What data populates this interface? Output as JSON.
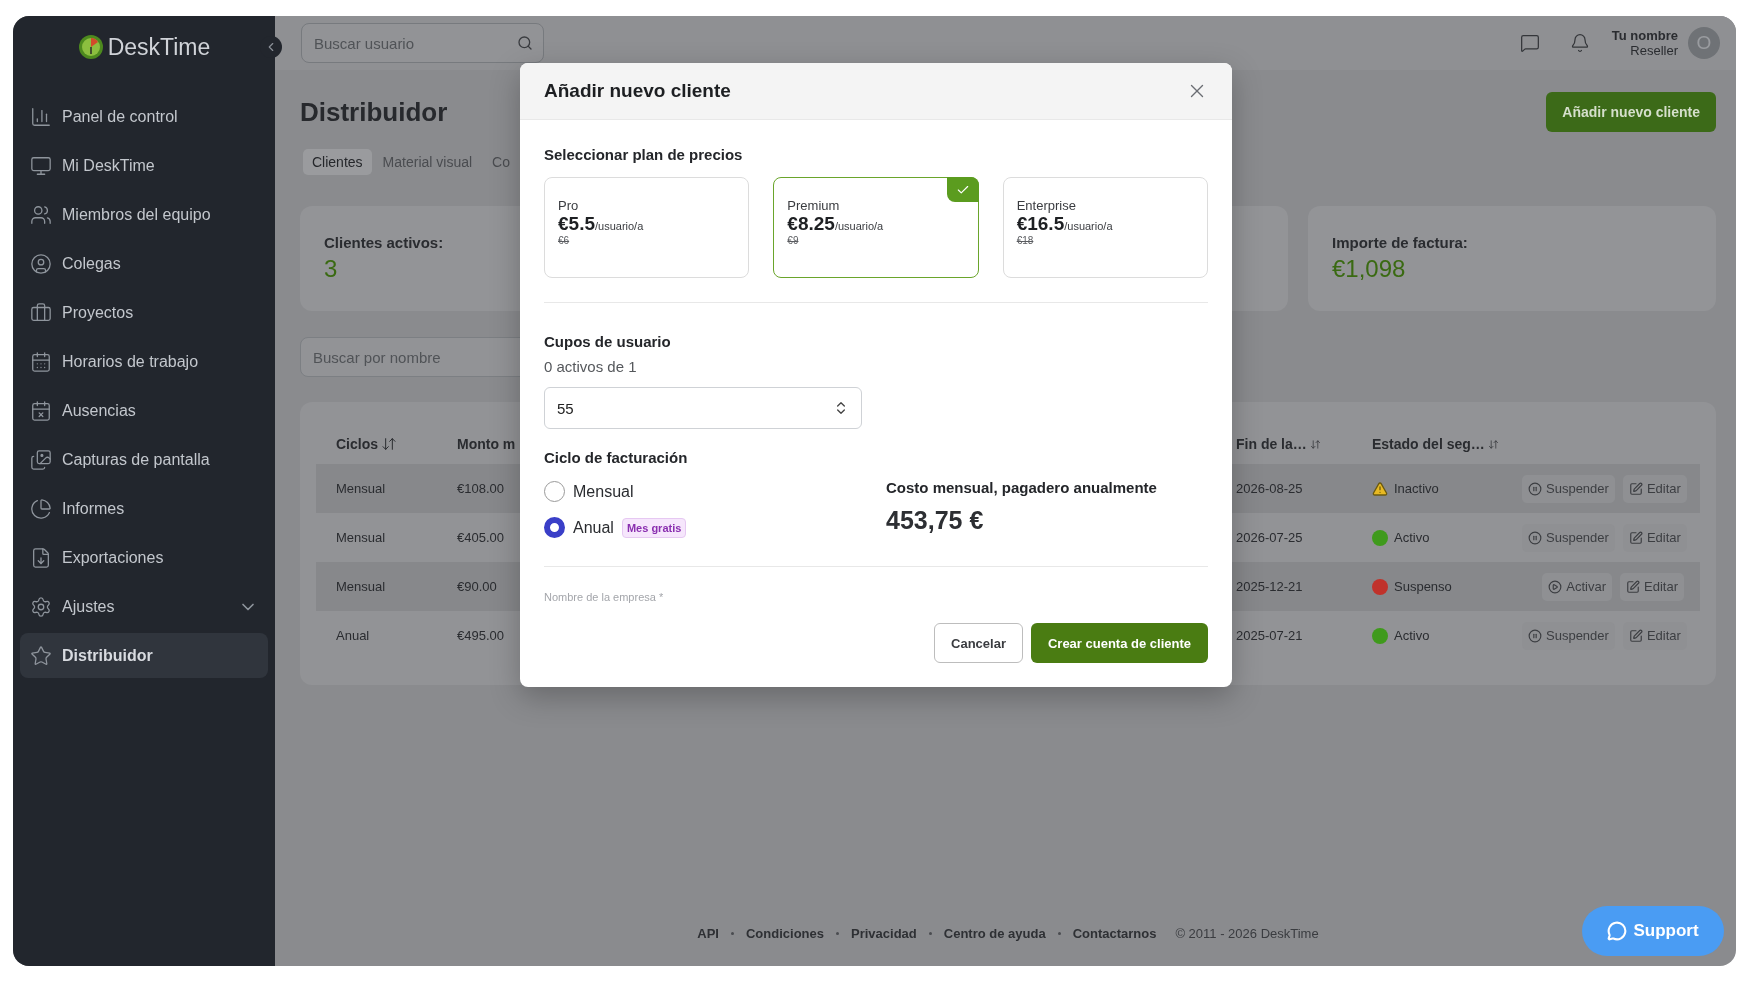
{
  "sidebar": {
    "logo": "DeskTime",
    "items": [
      {
        "label": "Panel de control",
        "selected": false,
        "kind": "link"
      },
      {
        "label": "Mi DeskTime",
        "selected": false,
        "kind": "link"
      },
      {
        "label": "Miembros del equipo",
        "selected": false,
        "kind": "link"
      },
      {
        "label": "Colegas",
        "selected": false,
        "kind": "link"
      },
      {
        "label": "Proyectos",
        "selected": false,
        "kind": "link"
      },
      {
        "label": "Horarios de trabajo",
        "selected": false,
        "kind": "link"
      },
      {
        "label": "Ausencias",
        "selected": false,
        "kind": "link"
      },
      {
        "label": "Capturas de pantalla",
        "selected": false,
        "kind": "link"
      },
      {
        "label": "Informes",
        "selected": false,
        "kind": "link"
      },
      {
        "label": "Exportaciones",
        "selected": false,
        "kind": "link"
      },
      {
        "label": "Ajustes",
        "selected": false,
        "kind": "group"
      },
      {
        "label": "Distribuidor",
        "selected": true,
        "kind": "link"
      }
    ]
  },
  "topbar": {
    "search": {
      "placeholder": "Buscar usuario"
    },
    "user": {
      "name": "Tu nombre",
      "role": "Reseller",
      "avatar": "O"
    }
  },
  "page": {
    "title": "Distribuidor",
    "tabs": [
      {
        "label": "Clientes",
        "selected": true
      },
      {
        "label": "Material visual",
        "selected": false
      },
      {
        "label": "Co",
        "selected": false
      }
    ],
    "add_button": "Añadir nuevo cliente",
    "stats": [
      {
        "label": "Clientes activos:",
        "value": "3"
      },
      {
        "label": "Importe de factura:",
        "value": "€1,098"
      }
    ],
    "filter": {
      "placeholder": "Buscar por nombre"
    },
    "table": {
      "columns": [
        {
          "label": "Ciclos",
          "sortable": true
        },
        {
          "label": "Monto m"
        },
        {
          "label": "Fin de la…",
          "sortable": true
        },
        {
          "label": "Estado del seg…",
          "sortable": true
        }
      ],
      "rows": [
        {
          "cycle": "Mensual",
          "amount": "€108.00",
          "end": "2026-08-25",
          "status": {
            "label": "Inactivo",
            "kind": "warning",
            "color": "#e8b923"
          },
          "actions": [
            {
              "kind": "suspend",
              "label": "Suspender"
            },
            {
              "kind": "edit",
              "label": "Editar"
            }
          ]
        },
        {
          "cycle": "Mensual",
          "amount": "€405.00",
          "end": "2026-07-25",
          "status": {
            "label": "Activo",
            "kind": "dot",
            "color": "#3f9a1c"
          },
          "actions": [
            {
              "kind": "suspend",
              "label": "Suspender"
            },
            {
              "kind": "edit",
              "label": "Editar"
            }
          ]
        },
        {
          "cycle": "Mensual",
          "amount": "€90.00",
          "end": "2025-12-21",
          "status": {
            "label": "Suspenso",
            "kind": "dot",
            "color": "#c0322b"
          },
          "actions": [
            {
              "kind": "activate",
              "label": "Activar"
            },
            {
              "kind": "edit",
              "label": "Editar"
            }
          ]
        },
        {
          "cycle": "Anual",
          "amount": "€495.00",
          "end": "2025-07-21",
          "status": {
            "label": "Activo",
            "kind": "dot",
            "color": "#3f9a1c"
          },
          "actions": [
            {
              "kind": "suspend",
              "label": "Suspender"
            },
            {
              "kind": "edit",
              "label": "Editar"
            }
          ]
        }
      ]
    }
  },
  "modal": {
    "title": "Añadir nuevo cliente",
    "plans_label": "Seleccionar plan de precios",
    "plans": [
      {
        "name": "Pro",
        "price": "€5.5",
        "unit": "/usuario/a",
        "old_price": "€6",
        "selected": false
      },
      {
        "name": "Premium",
        "price": "€8.25",
        "unit": "/usuario/a",
        "old_price": "€9",
        "selected": true
      },
      {
        "name": "Enterprise",
        "price": "€16.5",
        "unit": "/usuario/a",
        "old_price": "€18",
        "selected": false
      }
    ],
    "seats_label": "Cupos de usuario",
    "seats_hint": "0 activos de 1",
    "seats_value": "55",
    "billing_label": "Ciclo de facturación",
    "billing_options": [
      {
        "label": "Mensual",
        "selected": false
      },
      {
        "label": "Anual",
        "selected": true,
        "badge": "Mes gratis"
      }
    ],
    "cost_label": "Costo mensual, pagadero anualmente",
    "cost": "453,75 €",
    "next_field_label": "Nombre de la empresa *",
    "cancel_button": "Cancelar",
    "create_button": "Crear cuenta de cliente"
  },
  "footer": {
    "links": [
      "API",
      "Condiciones",
      "Privacidad",
      "Centro de ayuda",
      "Contactarnos"
    ],
    "copyright": "© 2011 - 2026 DeskTime"
  },
  "support_button": "Support"
}
